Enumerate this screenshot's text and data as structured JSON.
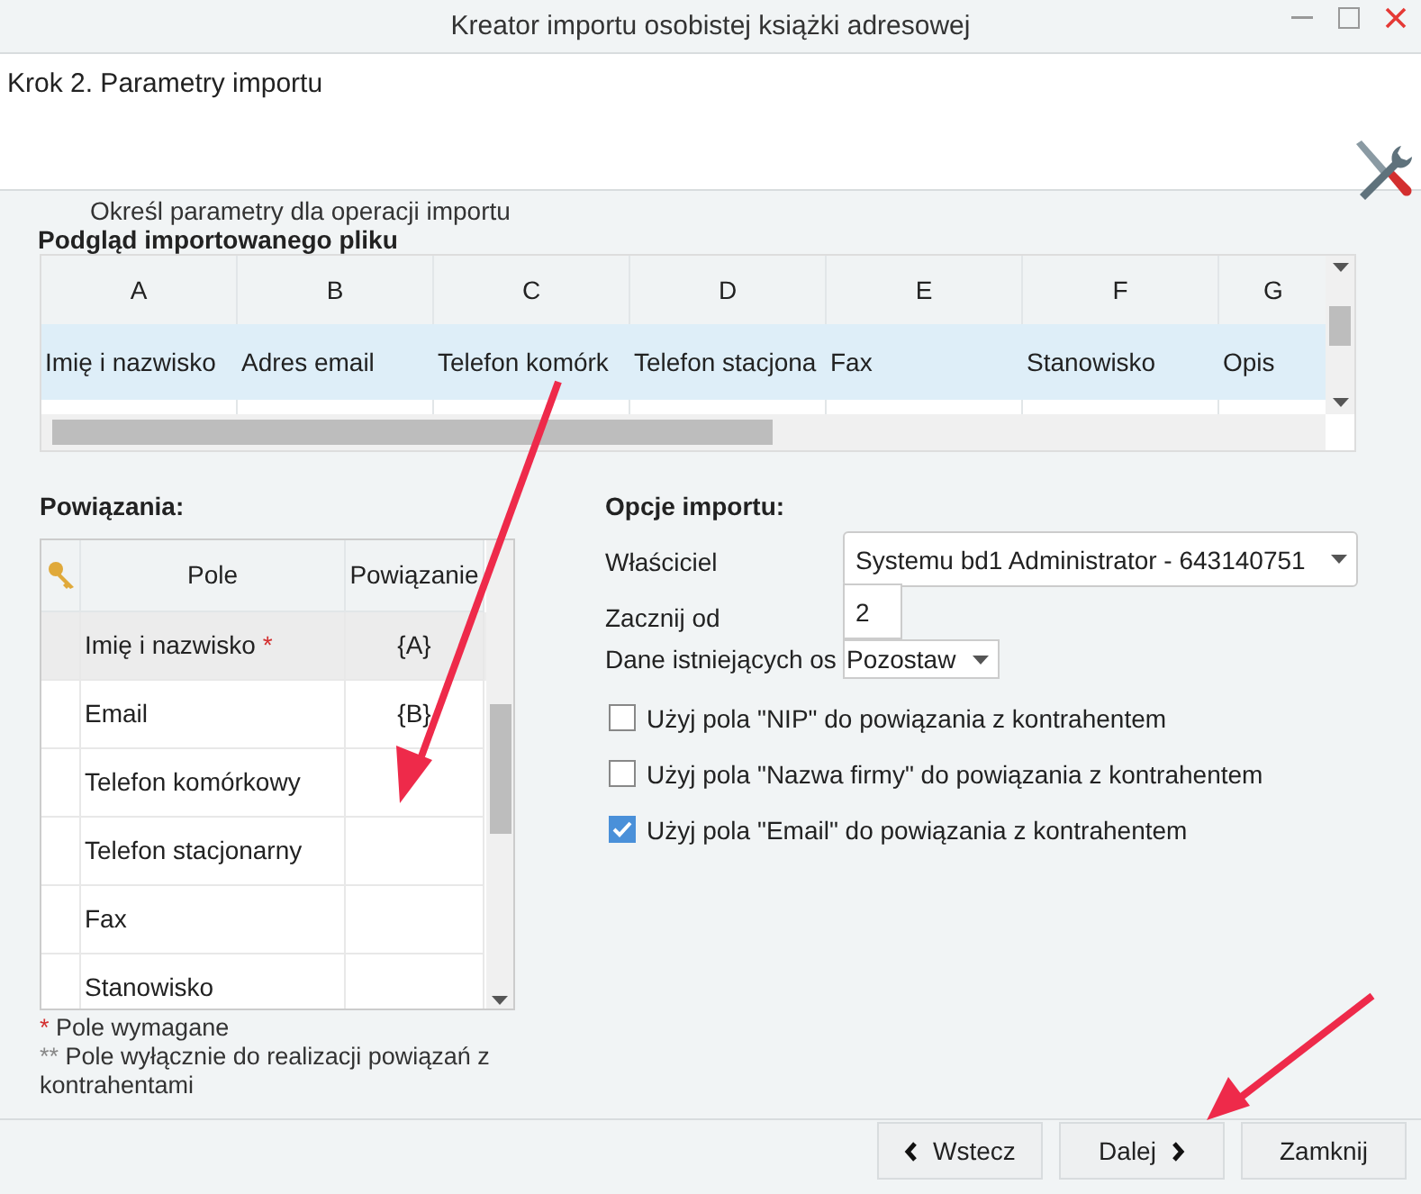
{
  "window": {
    "title": "Kreator importu osobistej książki adresowej"
  },
  "step": {
    "title": "Krok 2. Parametry importu",
    "subtitle": "Określ parametry dla operacji importu"
  },
  "preview": {
    "title": "Podgląd importowanego pliku",
    "columns": [
      "A",
      "B",
      "C",
      "D",
      "E",
      "F",
      "G"
    ],
    "row": [
      "Imię i nazwisko",
      "Adres email",
      "Telefon komórk",
      "Telefon stacjona",
      "Fax",
      "Stanowisko",
      "Opis"
    ]
  },
  "mappings": {
    "title": "Powiązania:",
    "columns": [
      "Pole",
      "Powiązanie"
    ],
    "rows": [
      {
        "field": "Imię i nazwisko",
        "required": "*",
        "binding": "{A}",
        "selected": true
      },
      {
        "field": "Email",
        "binding": "{B}",
        "selected": false
      },
      {
        "field": "Telefon komórkowy",
        "selected": false
      },
      {
        "field": "Telefon stacjonarny",
        "selected": false
      },
      {
        "field": "Fax",
        "selected": false
      },
      {
        "field": "Stanowisko",
        "selected": false
      }
    ]
  },
  "notes": [
    {
      "mark": "*",
      "kind": "required",
      "text": "Pole wymagane"
    },
    {
      "mark": "**",
      "kind": "partner",
      "text": "Pole wyłącznie do realizacji powiązań z kontrahentami"
    }
  ],
  "options": {
    "title": "Opcje importu:",
    "owner": {
      "label": "Właściciel",
      "value": "Systemu bd1 Administrator - 643140751"
    },
    "start": {
      "label": "Zacznij od",
      "value": "2"
    },
    "existing": {
      "label": "Dane istniejących os",
      "value": "Pozostaw"
    },
    "checks": [
      {
        "label": "Użyj pola \"NIP\" do powiązania z kontrahentem",
        "checked": false
      },
      {
        "label": "Użyj pola \"Nazwa firmy\" do powiązania z kontrahentem",
        "checked": false
      },
      {
        "label": "Użyj pola \"Email\" do powiązania z kontrahentem",
        "checked": true
      }
    ]
  },
  "buttons": [
    {
      "label": "Wstecz",
      "kind": "back"
    },
    {
      "label": "Dalej",
      "kind": "next"
    },
    {
      "label": "Zamknij",
      "kind": "plain"
    }
  ]
}
